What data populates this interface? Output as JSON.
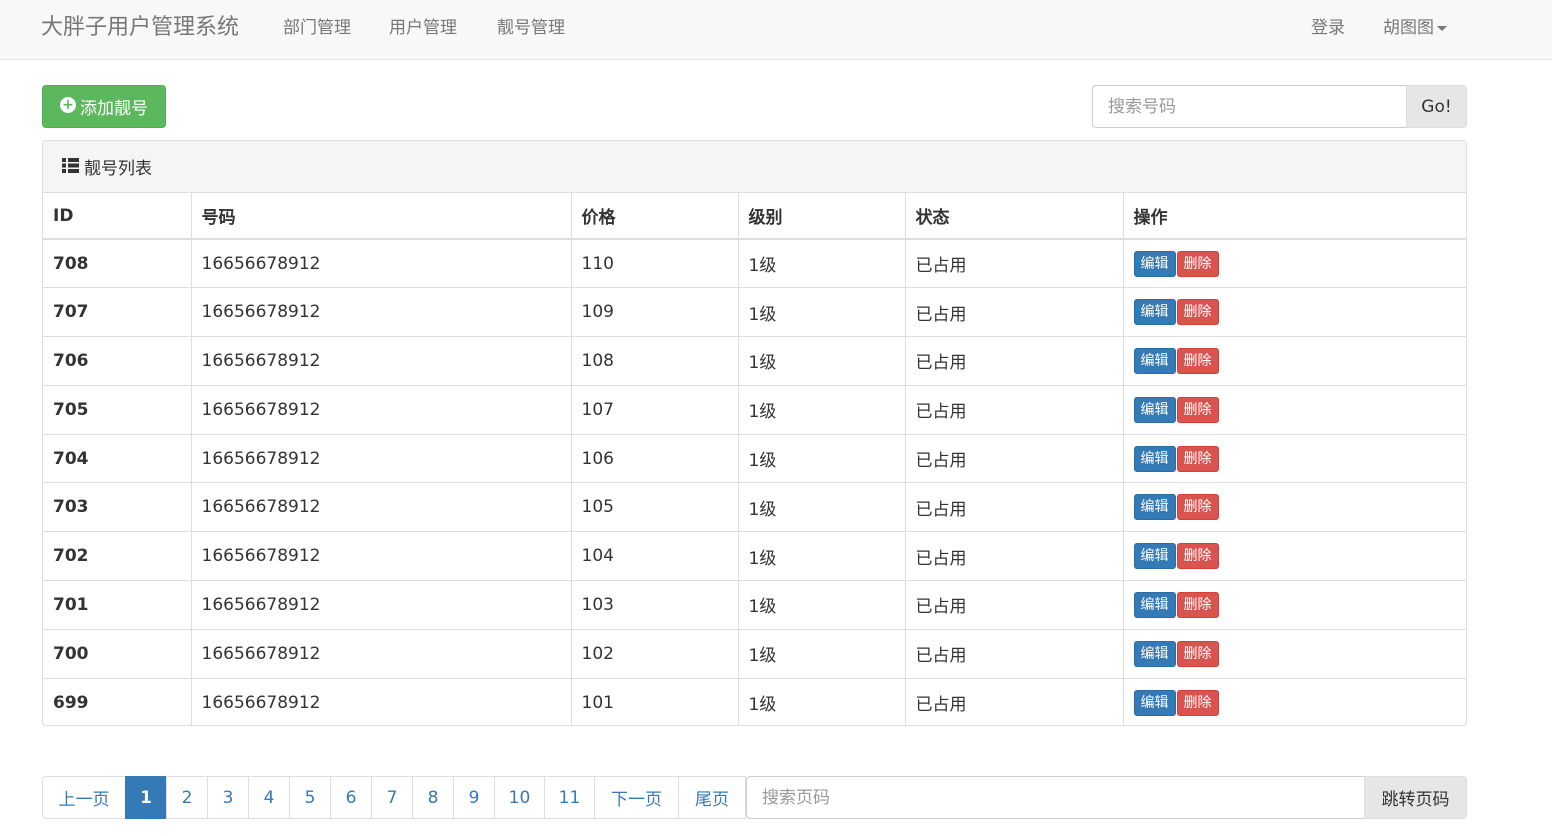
{
  "navbar": {
    "brand": "大胖子用户管理系统",
    "links": [
      "部门管理",
      "用户管理",
      "靓号管理"
    ],
    "login": "登录",
    "user": "胡图图"
  },
  "toolbar": {
    "add_label": "添加靓号",
    "search_placeholder": "搜索号码",
    "search_button": "Go!"
  },
  "panel": {
    "title": "靓号列表",
    "columns": [
      "ID",
      "号码",
      "价格",
      "级别",
      "状态",
      "操作"
    ],
    "edit_label": "编辑",
    "delete_label": "删除",
    "rows": [
      {
        "id": "708",
        "mobile": "16656678912",
        "price": "110",
        "level": "1级",
        "status": "已占用"
      },
      {
        "id": "707",
        "mobile": "16656678912",
        "price": "109",
        "level": "1级",
        "status": "已占用"
      },
      {
        "id": "706",
        "mobile": "16656678912",
        "price": "108",
        "level": "1级",
        "status": "已占用"
      },
      {
        "id": "705",
        "mobile": "16656678912",
        "price": "107",
        "level": "1级",
        "status": "已占用"
      },
      {
        "id": "704",
        "mobile": "16656678912",
        "price": "106",
        "level": "1级",
        "status": "已占用"
      },
      {
        "id": "703",
        "mobile": "16656678912",
        "price": "105",
        "level": "1级",
        "status": "已占用"
      },
      {
        "id": "702",
        "mobile": "16656678912",
        "price": "104",
        "level": "1级",
        "status": "已占用"
      },
      {
        "id": "701",
        "mobile": "16656678912",
        "price": "103",
        "level": "1级",
        "status": "已占用"
      },
      {
        "id": "700",
        "mobile": "16656678912",
        "price": "102",
        "level": "1级",
        "status": "已占用"
      },
      {
        "id": "699",
        "mobile": "16656678912",
        "price": "101",
        "level": "1级",
        "status": "已占用"
      }
    ]
  },
  "pagination": {
    "prev": "上一页",
    "pages": [
      "1",
      "2",
      "3",
      "4",
      "5",
      "6",
      "7",
      "8",
      "9",
      "10",
      "11"
    ],
    "active_page": "1",
    "next": "下一页",
    "last": "尾页",
    "search_placeholder": "搜索页码",
    "jump_label": "跳转页码"
  },
  "colors": {
    "primary": "#337ab7",
    "success": "#5cb85c",
    "danger": "#d9534f"
  }
}
